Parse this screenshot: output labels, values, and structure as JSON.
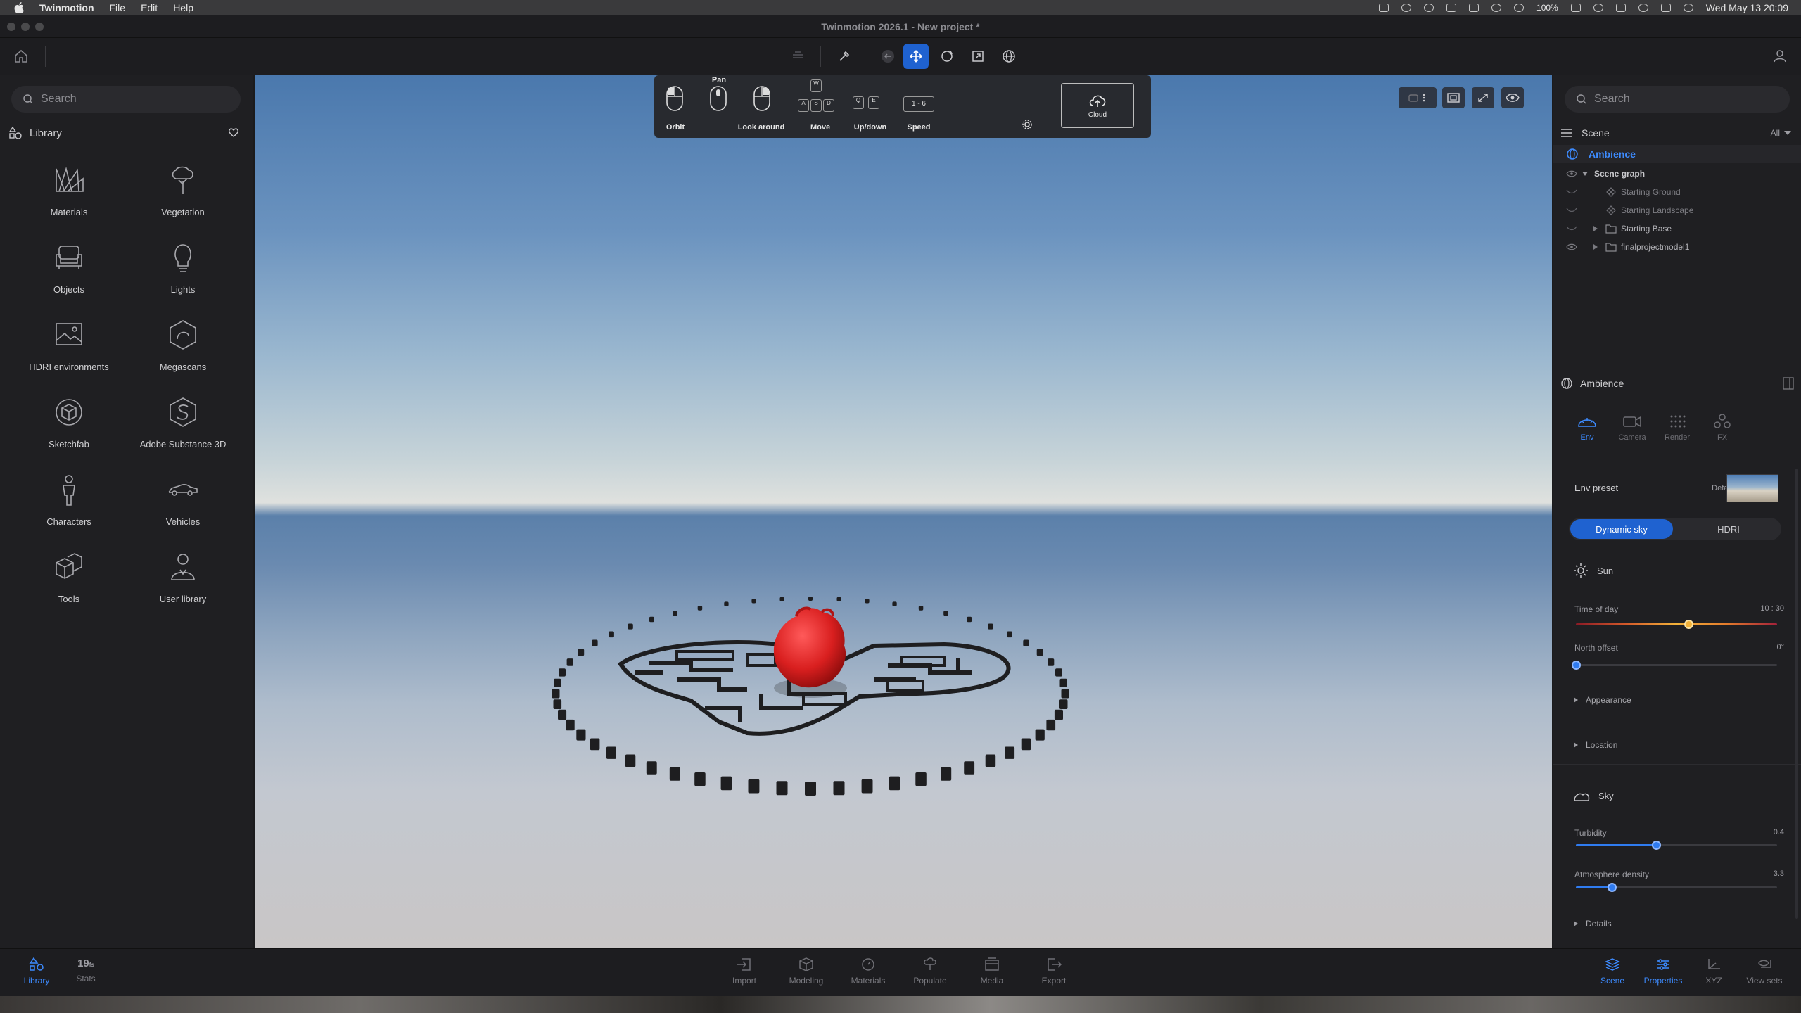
{
  "menubar": {
    "app_name": "Twinmotion",
    "menus": [
      "File",
      "Edit",
      "Help"
    ],
    "battery": "100%",
    "clock": "Wed May 13  20:09"
  },
  "window": {
    "title": "Twinmotion 2026.1 - New project *"
  },
  "left_panel": {
    "search_placeholder": "Search",
    "library_label": "Library",
    "items": [
      {
        "label": "Materials",
        "icon": "materials-icon"
      },
      {
        "label": "Vegetation",
        "icon": "tree-icon"
      },
      {
        "label": "Objects",
        "icon": "sofa-icon"
      },
      {
        "label": "Lights",
        "icon": "bulb-icon"
      },
      {
        "label": "HDRI environments",
        "icon": "image-icon"
      },
      {
        "label": "Megascans",
        "icon": "megascans-icon"
      },
      {
        "label": "Sketchfab",
        "icon": "sketchfab-icon"
      },
      {
        "label": "Adobe Substance 3D",
        "icon": "substance-icon"
      },
      {
        "label": "Characters",
        "icon": "person-icon"
      },
      {
        "label": "Vehicles",
        "icon": "car-icon"
      },
      {
        "label": "Tools",
        "icon": "boxes-icon"
      },
      {
        "label": "User library",
        "icon": "user-icon"
      }
    ]
  },
  "nav_hint": {
    "pan": "Pan",
    "orbit": "Orbit",
    "look_around": "Look around",
    "move": "Move",
    "updown": "Up/down",
    "speed": "Speed",
    "speed_keys": "1 - 6",
    "cloud": "Cloud",
    "keys": {
      "w": "W",
      "a": "A",
      "s": "S",
      "d": "D",
      "q": "Q",
      "e": "E"
    }
  },
  "right_panel": {
    "search_placeholder": "Search",
    "scene_label": "Scene",
    "filter": "All",
    "tree": {
      "ambience": "Ambience",
      "scene_graph": "Scene graph",
      "children": [
        "Starting Ground",
        "Starting Landscape",
        "Starting Base",
        "finalprojectmodel1"
      ]
    },
    "properties": {
      "header": "Ambience",
      "tabs": [
        "Env",
        "Camera",
        "Render",
        "FX"
      ],
      "env_preset_label": "Env preset",
      "env_preset_value": "Default",
      "toggle": [
        "Dynamic sky",
        "HDRI"
      ],
      "sun_label": "Sun",
      "time_of_day_label": "Time of day",
      "time_of_day_value": "10 : 30",
      "time_of_day_fraction": 0.56,
      "north_offset_label": "North offset",
      "north_offset_value": "0°",
      "north_offset_fraction": 0.0,
      "appearance_label": "Appearance",
      "location_label": "Location",
      "sky_label": "Sky",
      "turbidity_label": "Turbidity",
      "turbidity_value": "0.4",
      "turbidity_fraction": 0.4,
      "atmosphere_label": "Atmosphere density",
      "atmosphere_value": "3.3",
      "atmosphere_fraction": 0.18,
      "details_label": "Details"
    }
  },
  "bottombar": {
    "left": [
      {
        "label": "Library",
        "icon": "library-icon"
      },
      {
        "label": "Stats",
        "value": "19",
        "unit": "fs"
      }
    ],
    "center": [
      {
        "label": "Import"
      },
      {
        "label": "Modeling"
      },
      {
        "label": "Materials"
      },
      {
        "label": "Populate"
      },
      {
        "label": "Media"
      },
      {
        "label": "Export"
      }
    ],
    "right": [
      {
        "label": "Scene"
      },
      {
        "label": "Properties"
      },
      {
        "label": "XYZ"
      },
      {
        "label": "View sets"
      }
    ]
  },
  "colors": {
    "accent": "#1f62d0",
    "active_text": "#3d8bff",
    "panel": "#1f1f22",
    "model_red": "#d91f1f"
  }
}
